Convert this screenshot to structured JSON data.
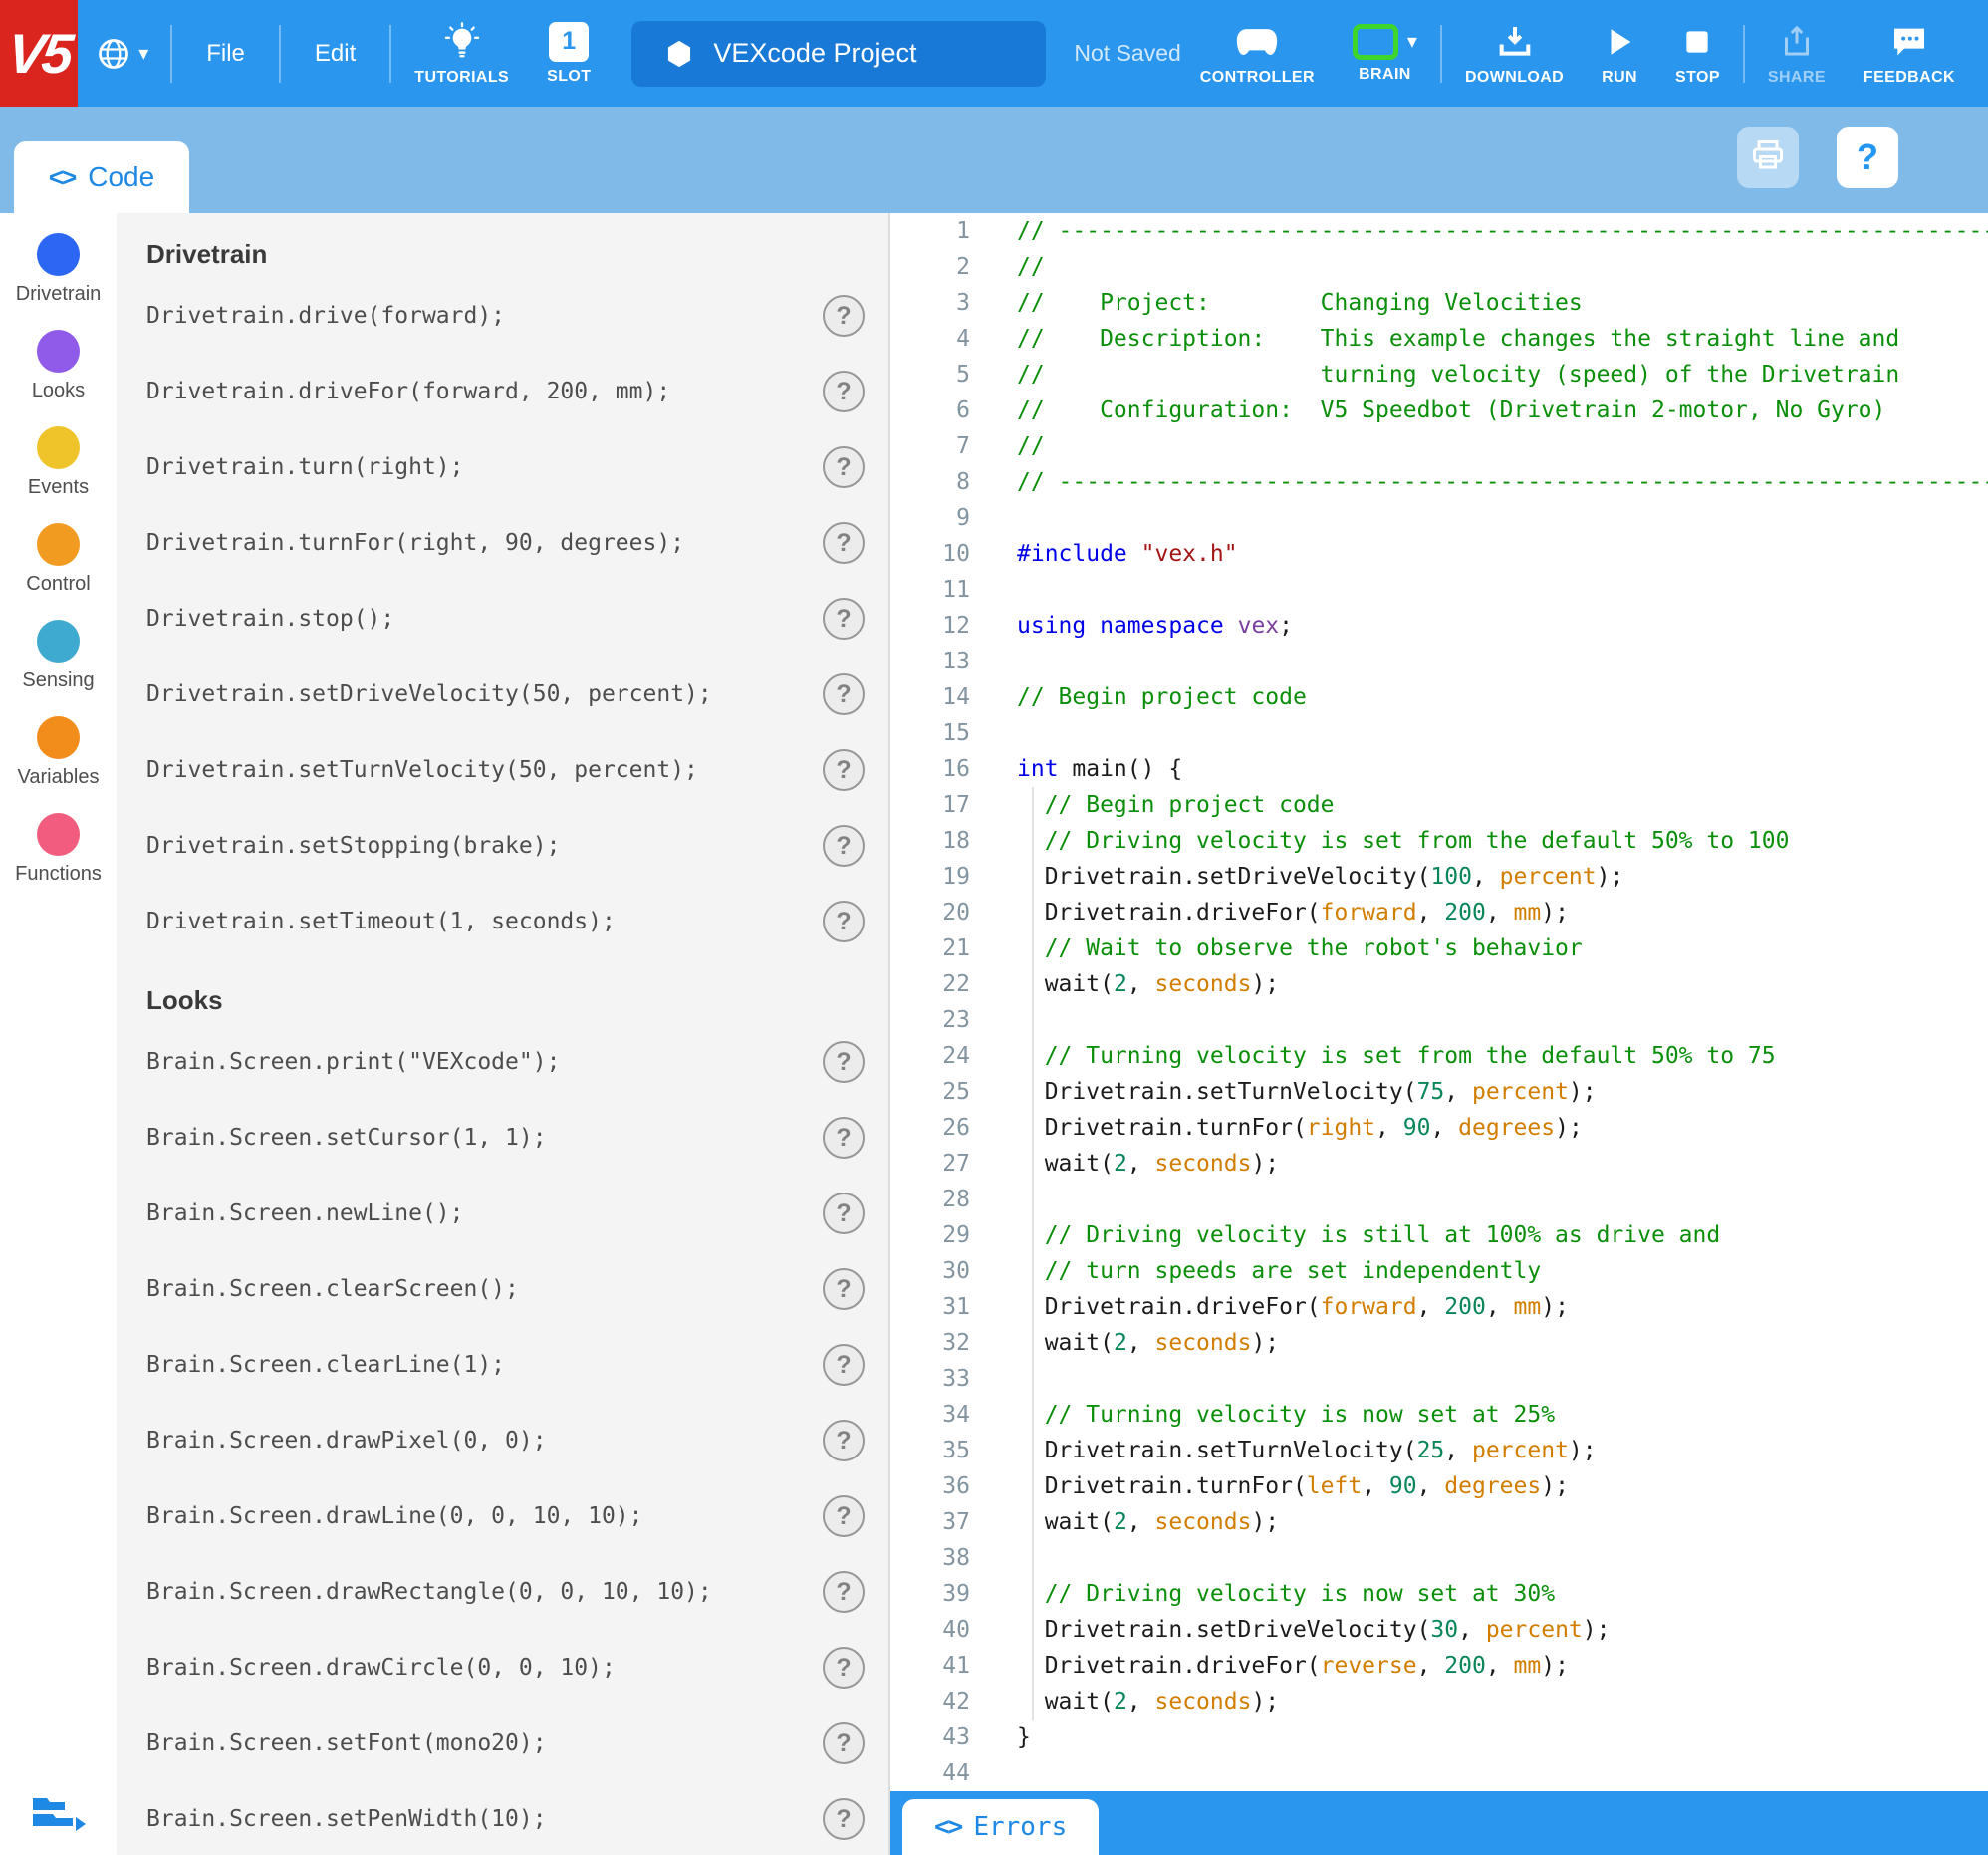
{
  "topbar": {
    "logo": "V5",
    "file": "File",
    "edit": "Edit",
    "tutorials": "TUTORIALS",
    "slot": "SLOT",
    "slot_number": "1",
    "project_name": "VEXcode Project",
    "save_status": "Not Saved",
    "controller": "CONTROLLER",
    "brain": "BRAIN",
    "download": "DOWNLOAD",
    "run": "RUN",
    "stop": "STOP",
    "share": "SHARE",
    "feedback": "FEEDBACK"
  },
  "codebar": {
    "tab": "Code"
  },
  "errorsbar": {
    "tab": "Errors"
  },
  "icons": {
    "caret_down": "▾",
    "angle_brackets": "<>",
    "help": "?"
  },
  "colors": {
    "brand_red": "#D9251D",
    "toolbar_blue": "#2B96EE",
    "codebar_blue": "#7FBAE9",
    "project_box_blue": "#1879D6",
    "brain_green": "#3FD62C",
    "accent_blue": "#1E88E5"
  },
  "sidebar": {
    "categories": [
      {
        "label": "Drivetrain",
        "color": "#2B67F2"
      },
      {
        "label": "Looks",
        "color": "#8F5BE8"
      },
      {
        "label": "Events",
        "color": "#EFC42A"
      },
      {
        "label": "Control",
        "color": "#F29B21"
      },
      {
        "label": "Sensing",
        "color": "#3FAAD0"
      },
      {
        "label": "Variables",
        "color": "#F28C1B"
      },
      {
        "label": "Functions",
        "color": "#F25C7F"
      }
    ]
  },
  "palette": {
    "help_glyph": "?",
    "sections": [
      {
        "title": "Drivetrain",
        "commands": [
          "Drivetrain.drive(forward);",
          "Drivetrain.driveFor(forward, 200, mm);",
          "Drivetrain.turn(right);",
          "Drivetrain.turnFor(right, 90, degrees);",
          "Drivetrain.stop();",
          "Drivetrain.setDriveVelocity(50, percent);",
          "Drivetrain.setTurnVelocity(50, percent);",
          "Drivetrain.setStopping(brake);",
          "Drivetrain.setTimeout(1, seconds);"
        ]
      },
      {
        "title": "Looks",
        "commands": [
          "Brain.Screen.print(\"VEXcode\");",
          "Brain.Screen.setCursor(1, 1);",
          "Brain.Screen.newLine();",
          "Brain.Screen.clearScreen();",
          "Brain.Screen.clearLine(1);",
          "Brain.Screen.drawPixel(0, 0);",
          "Brain.Screen.drawLine(0, 0, 10, 10);",
          "Brain.Screen.drawRectangle(0, 0, 10, 10);",
          "Brain.Screen.drawCircle(0, 0, 10);",
          "Brain.Screen.setFont(mono20);",
          "Brain.Screen.setPenWidth(10);"
        ]
      }
    ]
  },
  "editor": {
    "token_colors": {
      "p": "#1B1B1B",
      "c": "#0B8F0B",
      "k": "#0000E8",
      "s": "#A31515",
      "n": "#098658",
      "o": "#D17D00",
      "ns": "#7A3E9D"
    },
    "lines": [
      [
        [
          "c",
          "// ------------------------------------------------------------------------------------------"
        ]
      ],
      [
        [
          "c",
          "//"
        ]
      ],
      [
        [
          "c",
          "//    Project:        Changing Velocities"
        ]
      ],
      [
        [
          "c",
          "//    Description:    This example changes the straight line and"
        ]
      ],
      [
        [
          "c",
          "//                    turning velocity (speed) of the Drivetrain"
        ]
      ],
      [
        [
          "c",
          "//    Configuration:  V5 Speedbot (Drivetrain 2-motor, No Gyro)"
        ]
      ],
      [
        [
          "c",
          "//"
        ]
      ],
      [
        [
          "c",
          "// ------------------------------------------------------------------------------------------"
        ]
      ],
      [],
      [
        [
          "k",
          "#include"
        ],
        [
          "p",
          " "
        ],
        [
          "s",
          "\"vex.h\""
        ]
      ],
      [],
      [
        [
          "k",
          "using"
        ],
        [
          "p",
          " "
        ],
        [
          "k",
          "namespace"
        ],
        [
          "p",
          " "
        ],
        [
          "ns",
          "vex"
        ],
        [
          "p",
          ";"
        ]
      ],
      [],
      [
        [
          "c",
          "// Begin project code"
        ]
      ],
      [],
      [
        [
          "k",
          "int"
        ],
        [
          "p",
          " main() {"
        ]
      ],
      [
        [
          "c",
          "  // Begin project code"
        ]
      ],
      [
        [
          "c",
          "  // Driving velocity is set from the default 50% to 100"
        ]
      ],
      [
        [
          "p",
          "  Drivetrain.setDriveVelocity("
        ],
        [
          "n",
          "100"
        ],
        [
          "p",
          ", "
        ],
        [
          "o",
          "percent"
        ],
        [
          "p",
          ");"
        ]
      ],
      [
        [
          "p",
          "  Drivetrain.driveFor("
        ],
        [
          "o",
          "forward"
        ],
        [
          "p",
          ", "
        ],
        [
          "n",
          "200"
        ],
        [
          "p",
          ", "
        ],
        [
          "o",
          "mm"
        ],
        [
          "p",
          ");"
        ]
      ],
      [
        [
          "c",
          "  // Wait to observe the robot's behavior"
        ]
      ],
      [
        [
          "p",
          "  wait("
        ],
        [
          "n",
          "2"
        ],
        [
          "p",
          ", "
        ],
        [
          "o",
          "seconds"
        ],
        [
          "p",
          ");"
        ]
      ],
      [],
      [
        [
          "c",
          "  // Turning velocity is set from the default 50% to 75"
        ]
      ],
      [
        [
          "p",
          "  Drivetrain.setTurnVelocity("
        ],
        [
          "n",
          "75"
        ],
        [
          "p",
          ", "
        ],
        [
          "o",
          "percent"
        ],
        [
          "p",
          ");"
        ]
      ],
      [
        [
          "p",
          "  Drivetrain.turnFor("
        ],
        [
          "o",
          "right"
        ],
        [
          "p",
          ", "
        ],
        [
          "n",
          "90"
        ],
        [
          "p",
          ", "
        ],
        [
          "o",
          "degrees"
        ],
        [
          "p",
          ");"
        ]
      ],
      [
        [
          "p",
          "  wait("
        ],
        [
          "n",
          "2"
        ],
        [
          "p",
          ", "
        ],
        [
          "o",
          "seconds"
        ],
        [
          "p",
          ");"
        ]
      ],
      [],
      [
        [
          "c",
          "  // Driving velocity is still at 100% as drive and"
        ]
      ],
      [
        [
          "c",
          "  // turn speeds are set independently"
        ]
      ],
      [
        [
          "p",
          "  Drivetrain.driveFor("
        ],
        [
          "o",
          "forward"
        ],
        [
          "p",
          ", "
        ],
        [
          "n",
          "200"
        ],
        [
          "p",
          ", "
        ],
        [
          "o",
          "mm"
        ],
        [
          "p",
          ");"
        ]
      ],
      [
        [
          "p",
          "  wait("
        ],
        [
          "n",
          "2"
        ],
        [
          "p",
          ", "
        ],
        [
          "o",
          "seconds"
        ],
        [
          "p",
          ");"
        ]
      ],
      [],
      [
        [
          "c",
          "  // Turning velocity is now set at 25%"
        ]
      ],
      [
        [
          "p",
          "  Drivetrain.setTurnVelocity("
        ],
        [
          "n",
          "25"
        ],
        [
          "p",
          ", "
        ],
        [
          "o",
          "percent"
        ],
        [
          "p",
          ");"
        ]
      ],
      [
        [
          "p",
          "  Drivetrain.turnFor("
        ],
        [
          "o",
          "left"
        ],
        [
          "p",
          ", "
        ],
        [
          "n",
          "90"
        ],
        [
          "p",
          ", "
        ],
        [
          "o",
          "degrees"
        ],
        [
          "p",
          ");"
        ]
      ],
      [
        [
          "p",
          "  wait("
        ],
        [
          "n",
          "2"
        ],
        [
          "p",
          ", "
        ],
        [
          "o",
          "seconds"
        ],
        [
          "p",
          ");"
        ]
      ],
      [],
      [
        [
          "c",
          "  // Driving velocity is now set at 30%"
        ]
      ],
      [
        [
          "p",
          "  Drivetrain.setDriveVelocity("
        ],
        [
          "n",
          "30"
        ],
        [
          "p",
          ", "
        ],
        [
          "o",
          "percent"
        ],
        [
          "p",
          ");"
        ]
      ],
      [
        [
          "p",
          "  Drivetrain.driveFor("
        ],
        [
          "o",
          "reverse"
        ],
        [
          "p",
          ", "
        ],
        [
          "n",
          "200"
        ],
        [
          "p",
          ", "
        ],
        [
          "o",
          "mm"
        ],
        [
          "p",
          ");"
        ]
      ],
      [
        [
          "p",
          "  wait("
        ],
        [
          "n",
          "2"
        ],
        [
          "p",
          ", "
        ],
        [
          "o",
          "seconds"
        ],
        [
          "p",
          ");"
        ]
      ],
      [
        [
          "p",
          "}"
        ]
      ],
      []
    ]
  }
}
